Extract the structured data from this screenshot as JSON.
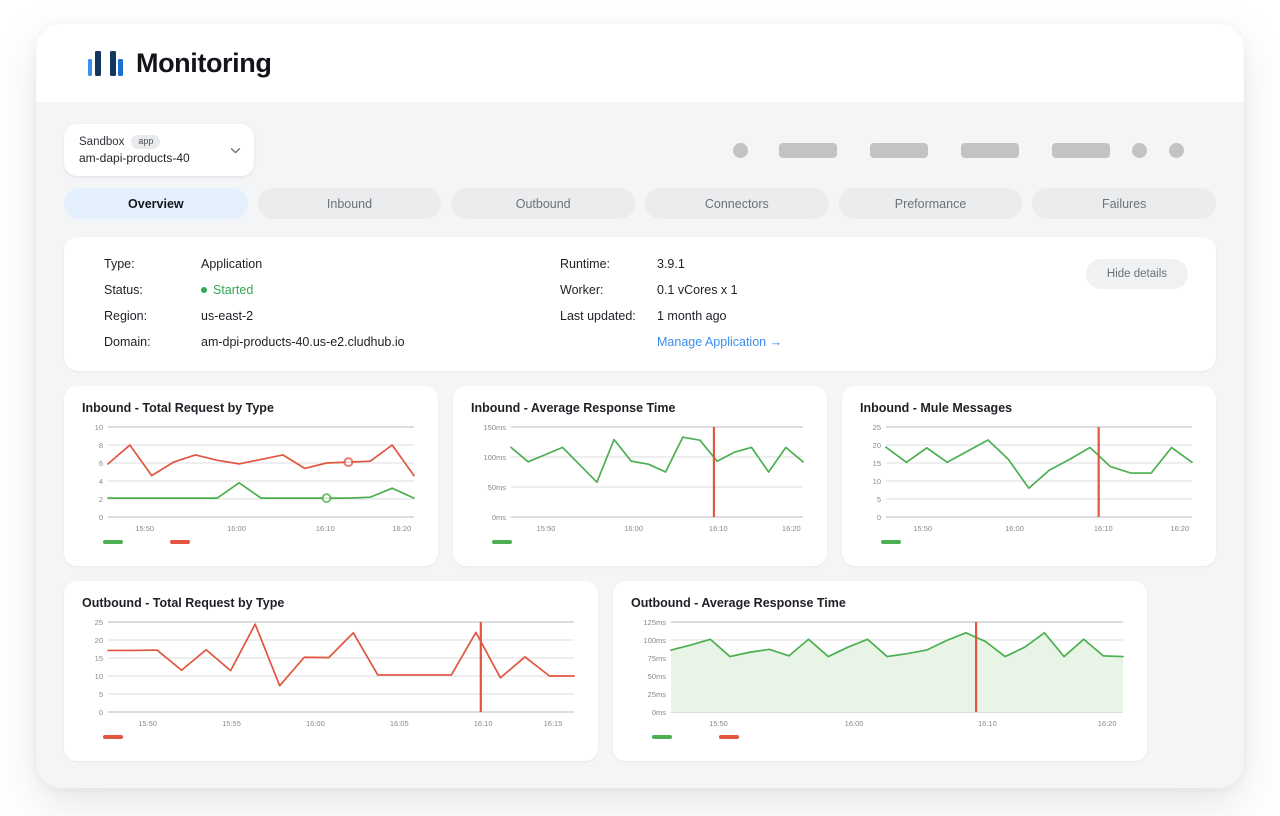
{
  "header": {
    "title": "Monitoring",
    "logo_icon": "bar-chart-logo-icon"
  },
  "env_selector": {
    "env_label": "Sandbox",
    "badge": "app",
    "app_name": "am-dapi-products-40",
    "chevron_icon": "chevron-down-icon"
  },
  "tabs": [
    {
      "label": "Overview",
      "active": true
    },
    {
      "label": "Inbound",
      "active": false
    },
    {
      "label": "Outbound",
      "active": false
    },
    {
      "label": "Connectors",
      "active": false
    },
    {
      "label": "Preformance",
      "active": false
    },
    {
      "label": "Failures",
      "active": false
    }
  ],
  "details": {
    "hide_button": "Hide details",
    "left": [
      {
        "key": "Type:",
        "value": "Application"
      },
      {
        "key": "Status:",
        "value": "Started",
        "status": true
      },
      {
        "key": "Region:",
        "value": "us-east-2"
      },
      {
        "key": "Domain:",
        "value": "am-dpi-products-40.us-e2.cludhub.io"
      }
    ],
    "right": [
      {
        "key": "Runtime:",
        "value": "3.9.1"
      },
      {
        "key": "Worker:",
        "value": "0.1 vCores x 1"
      },
      {
        "key": "Last updated:",
        "value": "1 month ago"
      }
    ],
    "link": "Manage Application →",
    "status_color": "#34a853",
    "link_color": "#3b8ff0"
  },
  "colors": {
    "green": "#4caf50",
    "red": "#e2553f",
    "grid": "#d9dadd",
    "axis_text": "#85898f"
  },
  "chart_data": [
    {
      "id": "inbound-total-request-by-type",
      "type": "line",
      "title": "Inbound - Total Request by Type",
      "xlabel": "",
      "ylabel": "",
      "ylim": [
        0,
        10
      ],
      "yticks": [
        0,
        2,
        4,
        6,
        8,
        10
      ],
      "yticklabels": [
        "0",
        "2",
        "4",
        "6",
        "8",
        "10"
      ],
      "xticklabels": [
        "15:50",
        "16:00",
        "16:10",
        "16:20"
      ],
      "xtickpos": [
        0.12,
        0.42,
        0.71,
        0.96
      ],
      "grid": true,
      "legend": [
        "green",
        "red"
      ],
      "series": [
        {
          "name": "green",
          "color": "#4caf50",
          "values": [
            2.1,
            2.1,
            2.1,
            2.1,
            2.1,
            2.1,
            3.8,
            2.1,
            2.1,
            2.1,
            2.1,
            2.1,
            2.2,
            3.2,
            2.1
          ]
        },
        {
          "name": "red",
          "color": "#e2553f",
          "values": [
            5.9,
            8.0,
            4.6,
            6.1,
            6.9,
            6.3,
            5.9,
            6.4,
            6.9,
            5.4,
            6.0,
            6.1,
            6.2,
            8.0,
            4.6
          ]
        }
      ],
      "markers": [
        {
          "series": "red",
          "index": 11,
          "value": 6.1
        },
        {
          "series": "green",
          "index": 10,
          "value": 2.1
        }
      ]
    },
    {
      "id": "inbound-average-response-time",
      "type": "line",
      "title": "Inbound - Average Response Time",
      "ylim": [
        0,
        150
      ],
      "yticks": [
        0,
        50,
        100,
        150
      ],
      "yticklabels": [
        "0ms",
        "50ms",
        "100ms",
        "150ms"
      ],
      "xticklabels": [
        "15:50",
        "16:00",
        "16:10",
        "16:20"
      ],
      "xtickpos": [
        0.12,
        0.42,
        0.71,
        0.96
      ],
      "grid": true,
      "legend": [
        "green"
      ],
      "marker_line": {
        "x": 0.695,
        "color": "#e2553f",
        "top": 152
      },
      "series": [
        {
          "name": "green",
          "color": "#4caf50",
          "values": [
            116,
            92,
            104,
            116,
            87,
            58,
            129,
            93,
            88,
            75,
            133,
            128,
            93,
            108,
            116,
            75,
            116,
            92
          ]
        }
      ]
    },
    {
      "id": "inbound-mule-messages",
      "type": "line",
      "title": "Inbound - Mule Messages",
      "ylim": [
        0,
        25
      ],
      "yticks": [
        0,
        5,
        10,
        15,
        20,
        25
      ],
      "yticklabels": [
        "0",
        "5",
        "10",
        "15",
        "20",
        "25"
      ],
      "xticklabels": [
        "15:50",
        "16:00",
        "16:10",
        "16:20"
      ],
      "xtickpos": [
        0.12,
        0.42,
        0.71,
        0.96
      ],
      "grid": true,
      "legend": [
        "green"
      ],
      "marker_line": {
        "x": 0.695,
        "color": "#e2553f",
        "top": 25.5
      },
      "series": [
        {
          "name": "green",
          "color": "#4caf50",
          "values": [
            19.4,
            15.2,
            19.2,
            15.2,
            18.3,
            21.4,
            16.0,
            8.0,
            13.0,
            16.0,
            19.3,
            14.0,
            12.2,
            12.2,
            19.3,
            15.2
          ]
        }
      ]
    },
    {
      "id": "outbound-total-request-by-type",
      "type": "line",
      "title": "Outbound - Total Request by Type",
      "ylim": [
        0,
        25
      ],
      "yticks": [
        0,
        5,
        10,
        15,
        20,
        25
      ],
      "yticklabels": [
        "0",
        "5",
        "10",
        "15",
        "20",
        "25"
      ],
      "xticklabels": [
        "15:50",
        "15:55",
        "16:00",
        "16:05",
        "16:10",
        "16:15"
      ],
      "xtickpos": [
        0.085,
        0.265,
        0.445,
        0.625,
        0.805,
        0.955
      ],
      "grid": true,
      "legend": [
        "red"
      ],
      "marker_line": {
        "x": 0.8,
        "color": "#e2553f",
        "top": 25
      },
      "series": [
        {
          "name": "red",
          "color": "#e2553f",
          "values": [
            17.1,
            17.1,
            17.2,
            11.6,
            17.3,
            11.5,
            24.4,
            7.3,
            15.2,
            15.1,
            22.0,
            10.3,
            10.3,
            10.3,
            10.3,
            22.1,
            9.5,
            15.3,
            10.0,
            10.0
          ]
        }
      ]
    },
    {
      "id": "outbound-average-response-time",
      "type": "area",
      "title": "Outbound - Average Response Time",
      "ylim": [
        0,
        125
      ],
      "yticks": [
        0,
        25,
        50,
        75,
        100,
        125
      ],
      "yticklabels": [
        "0ms",
        "25ms",
        "50ms",
        "75ms",
        "100ms",
        "125ms"
      ],
      "xticklabels": [
        "15:50",
        "16:00",
        "16:10",
        "16:20"
      ],
      "xtickpos": [
        0.105,
        0.405,
        0.7,
        0.965
      ],
      "grid": true,
      "legend": [
        "green",
        "red"
      ],
      "marker_line": {
        "x": 0.675,
        "color": "#e2553f",
        "top": 125
      },
      "series": [
        {
          "name": "green",
          "color": "#4caf50",
          "fill": "#e8f4e6",
          "values": [
            86,
            93,
            101,
            77,
            83,
            87,
            78,
            101,
            77,
            90,
            101,
            77,
            81,
            86,
            99,
            110,
            98,
            77,
            90,
            110,
            77,
            101,
            78,
            77
          ]
        }
      ]
    }
  ],
  "skeletons": [
    {
      "shape": "dot",
      "w": 15
    },
    {
      "shape": "pill",
      "w": 58
    },
    {
      "shape": "pill",
      "w": 58
    },
    {
      "shape": "pill",
      "w": 58
    },
    {
      "shape": "pill",
      "w": 58
    },
    {
      "shape": "dot",
      "w": 15
    },
    {
      "shape": "dot",
      "w": 15
    }
  ]
}
